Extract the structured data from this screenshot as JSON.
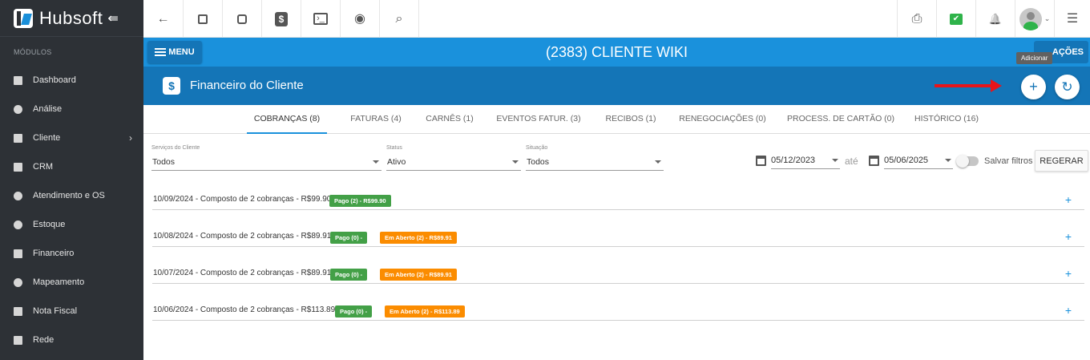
{
  "sidebar": {
    "brand": "Hubsoft",
    "collapse_glyph": "⇚",
    "section_label": "MÓDULOS",
    "items": [
      {
        "label": "Dashboard",
        "icon": "dashboard-icon"
      },
      {
        "label": "Análise",
        "icon": "pie-chart-icon"
      },
      {
        "label": "Cliente",
        "icon": "client-card-icon",
        "has_chevron": true
      },
      {
        "label": "CRM",
        "icon": "crm-board-icon"
      },
      {
        "label": "Atendimento e OS",
        "icon": "calendar-clock-icon"
      },
      {
        "label": "Estoque",
        "icon": "box-icon"
      },
      {
        "label": "Financeiro",
        "icon": "money-icon"
      },
      {
        "label": "Mapeamento",
        "icon": "map-pin-icon"
      },
      {
        "label": "Nota Fiscal",
        "icon": "invoice-icon"
      },
      {
        "label": "Rede",
        "icon": "network-icon"
      }
    ]
  },
  "topbar": {
    "back_glyph": "←",
    "search_glyph": "⌕",
    "terminal_glyph": "›_",
    "eye_glyph": "◉",
    "pdf_glyph": "⎙",
    "bell_glyph": "🔔",
    "list_glyph": "☰",
    "chat_glyph": "✔",
    "dollar_glyph": "$",
    "avatar_caret": "⌄"
  },
  "client_bar": {
    "menu_label": "MENU",
    "title": "(2383) CLIENTE WIKI",
    "acoes_label": "AÇÕES",
    "tooltip": "Adicionar"
  },
  "section": {
    "icon_glyph": "$",
    "title": "Financeiro do Cliente",
    "add_glyph": "+",
    "refresh_glyph": "↻"
  },
  "tabs": [
    {
      "label": "COBRANÇAS (8)",
      "active": true
    },
    {
      "label": "FATURAS (4)"
    },
    {
      "label": "CARNÊS (1)"
    },
    {
      "label": "EVENTOS FATUR. (3)"
    },
    {
      "label": "RECIBOS (1)"
    },
    {
      "label": "RENEGOCIAÇÕES (0)"
    },
    {
      "label": "PROCESS. DE CARTÃO (0)"
    },
    {
      "label": "HISTÓRICO (16)"
    }
  ],
  "filters": {
    "servicos": {
      "label": "Serviços do Cliente",
      "value": "Todos"
    },
    "status": {
      "label": "Status",
      "value": "Ativo"
    },
    "situacao": {
      "label": "Situação",
      "value": "Todos"
    },
    "date_from": "05/12/2023",
    "date_sep": "até",
    "date_to": "05/06/2025",
    "salvar_label": "Salvar filtros",
    "regerar_label": "REGERAR"
  },
  "rows": [
    {
      "text": "10/09/2024 - Composto de 2 cobranças - R$99.90",
      "badges": [
        {
          "label": "Pago (2) - R$99.90",
          "color": "#43a047"
        }
      ]
    },
    {
      "text": "10/08/2024 - Composto de 2 cobranças - R$89.91",
      "badges": [
        {
          "label": "Pago (0) -",
          "color": "#43a047"
        },
        {
          "label": "Em Aberto (2) - R$89.91",
          "color": "#fb8c00"
        }
      ]
    },
    {
      "text": "10/07/2024 - Composto de 2 cobranças - R$89.91",
      "badges": [
        {
          "label": "Pago (0) -",
          "color": "#43a047"
        },
        {
          "label": "Em Aberto (2) - R$89.91",
          "color": "#fb8c00"
        }
      ]
    },
    {
      "text": "10/06/2024 - Composto de 2 cobranças - R$113.89",
      "badges": [
        {
          "label": "Pago (0) -",
          "color": "#43a047"
        },
        {
          "label": "Em Aberto (2) - R$113.89",
          "color": "#fb8c00"
        }
      ]
    }
  ],
  "row_plus": "+",
  "colors": {
    "sidebar": "#2d3136",
    "primary": "#1a91dc",
    "primary_dark": "#1475b7",
    "annotation_arrow": "#e8141a"
  }
}
